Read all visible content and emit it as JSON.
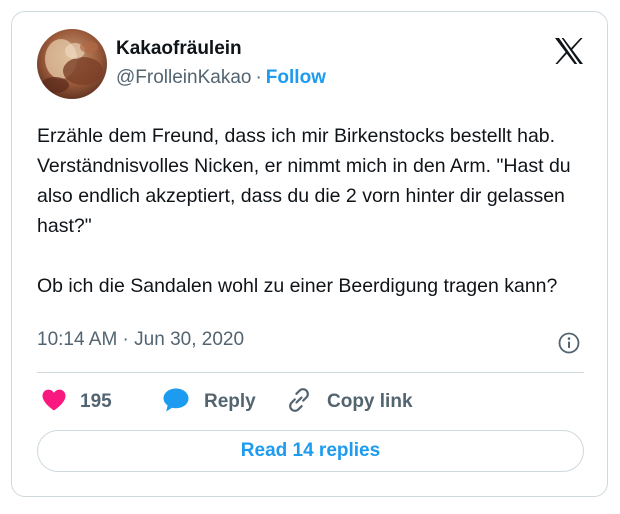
{
  "author": {
    "display_name": "Kakaofräulein",
    "handle": "@FrolleinKakao",
    "separator": "·",
    "follow_label": "Follow"
  },
  "tweet": {
    "lines": [
      "Erzähle dem Freund, dass ich mir Birkenstocks bestellt hab.",
      "Verständnisvolles Nicken, er nimmt mich in den Arm. \"Hast du also endlich akzeptiert, dass du die 2 vorn hinter dir gelassen hast?\"",
      "Ob ich die Sandalen wohl zu einer Beerdigung tragen kann?"
    ]
  },
  "meta": {
    "time": "10:14 AM · Jun 30, 2020"
  },
  "actions": {
    "like_count": "195",
    "reply_label": "Reply",
    "copy_label": "Copy link"
  },
  "read_replies_label": "Read 14 replies",
  "colors": {
    "accent": "#1d9bf0",
    "like": "#f91880",
    "muted": "#536471",
    "border": "#cfd9de"
  },
  "icons": {
    "brand": "x-logo-icon",
    "info": "info-icon",
    "like": "heart-icon",
    "reply": "speech-bubble-icon",
    "copy": "link-icon"
  }
}
